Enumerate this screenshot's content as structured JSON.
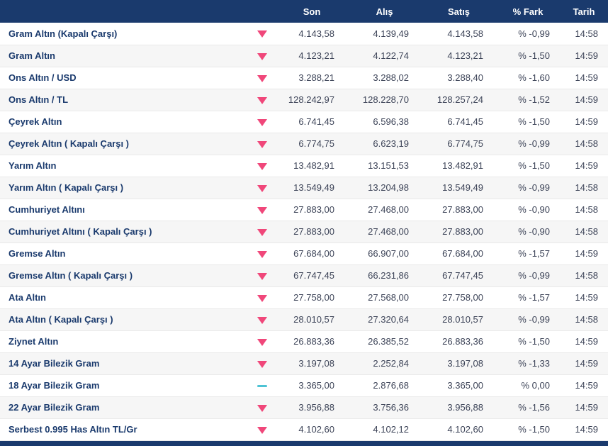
{
  "colors": {
    "header_bg": "#1a3a6d",
    "row_alt_bg": "#f6f6f6",
    "name_text": "#1a3a6d",
    "value_text": "#3d4458",
    "trend_down": "#f0477a",
    "trend_flat": "#4ec3d4"
  },
  "table": {
    "headers": {
      "instrument": "",
      "son": "Son",
      "alis": "Alış",
      "satis": "Satış",
      "fark": "% Fark",
      "tarih": "Tarih"
    },
    "rows": [
      {
        "name": "Gram Altın (Kapalı Çarşı)",
        "trend": "down",
        "son": "4.143,58",
        "alis": "4.139,49",
        "satis": "4.143,58",
        "fark": "% -0,99",
        "tarih": "14:58"
      },
      {
        "name": "Gram Altın",
        "trend": "down",
        "son": "4.123,21",
        "alis": "4.122,74",
        "satis": "4.123,21",
        "fark": "% -1,50",
        "tarih": "14:59"
      },
      {
        "name": "Ons Altın / USD",
        "trend": "down",
        "son": "3.288,21",
        "alis": "3.288,02",
        "satis": "3.288,40",
        "fark": "% -1,60",
        "tarih": "14:59"
      },
      {
        "name": "Ons Altın / TL",
        "trend": "down",
        "son": "128.242,97",
        "alis": "128.228,70",
        "satis": "128.257,24",
        "fark": "% -1,52",
        "tarih": "14:59"
      },
      {
        "name": "Çeyrek Altın",
        "trend": "down",
        "son": "6.741,45",
        "alis": "6.596,38",
        "satis": "6.741,45",
        "fark": "% -1,50",
        "tarih": "14:59"
      },
      {
        "name": "Çeyrek Altın ( Kapalı Çarşı )",
        "trend": "down",
        "son": "6.774,75",
        "alis": "6.623,19",
        "satis": "6.774,75",
        "fark": "% -0,99",
        "tarih": "14:58"
      },
      {
        "name": "Yarım Altın",
        "trend": "down",
        "son": "13.482,91",
        "alis": "13.151,53",
        "satis": "13.482,91",
        "fark": "% -1,50",
        "tarih": "14:59"
      },
      {
        "name": "Yarım Altın ( Kapalı Çarşı )",
        "trend": "down",
        "son": "13.549,49",
        "alis": "13.204,98",
        "satis": "13.549,49",
        "fark": "% -0,99",
        "tarih": "14:58"
      },
      {
        "name": "Cumhuriyet Altını",
        "trend": "down",
        "son": "27.883,00",
        "alis": "27.468,00",
        "satis": "27.883,00",
        "fark": "% -0,90",
        "tarih": "14:58"
      },
      {
        "name": "Cumhuriyet Altını ( Kapalı Çarşı )",
        "trend": "down",
        "son": "27.883,00",
        "alis": "27.468,00",
        "satis": "27.883,00",
        "fark": "% -0,90",
        "tarih": "14:58"
      },
      {
        "name": "Gremse Altın",
        "trend": "down",
        "son": "67.684,00",
        "alis": "66.907,00",
        "satis": "67.684,00",
        "fark": "% -1,57",
        "tarih": "14:59"
      },
      {
        "name": "Gremse Altın ( Kapalı Çarşı )",
        "trend": "down",
        "son": "67.747,45",
        "alis": "66.231,86",
        "satis": "67.747,45",
        "fark": "% -0,99",
        "tarih": "14:58"
      },
      {
        "name": "Ata Altın",
        "trend": "down",
        "son": "27.758,00",
        "alis": "27.568,00",
        "satis": "27.758,00",
        "fark": "% -1,57",
        "tarih": "14:59"
      },
      {
        "name": "Ata Altın ( Kapalı Çarşı )",
        "trend": "down",
        "son": "28.010,57",
        "alis": "27.320,64",
        "satis": "28.010,57",
        "fark": "% -0,99",
        "tarih": "14:58"
      },
      {
        "name": "Ziynet Altın",
        "trend": "down",
        "son": "26.883,36",
        "alis": "26.385,52",
        "satis": "26.883,36",
        "fark": "% -1,50",
        "tarih": "14:59"
      },
      {
        "name": "14 Ayar Bilezik Gram",
        "trend": "down",
        "son": "3.197,08",
        "alis": "2.252,84",
        "satis": "3.197,08",
        "fark": "% -1,33",
        "tarih": "14:59"
      },
      {
        "name": "18 Ayar Bilezik Gram",
        "trend": "flat",
        "son": "3.365,00",
        "alis": "2.876,68",
        "satis": "3.365,00",
        "fark": "% 0,00",
        "tarih": "14:59"
      },
      {
        "name": "22 Ayar Bilezik Gram",
        "trend": "down",
        "son": "3.956,88",
        "alis": "3.756,36",
        "satis": "3.956,88",
        "fark": "% -1,56",
        "tarih": "14:59"
      },
      {
        "name": "Serbest 0.995 Has Altın TL/Gr",
        "trend": "down",
        "son": "4.102,60",
        "alis": "4.102,12",
        "satis": "4.102,60",
        "fark": "% -1,50",
        "tarih": "14:59"
      }
    ]
  }
}
